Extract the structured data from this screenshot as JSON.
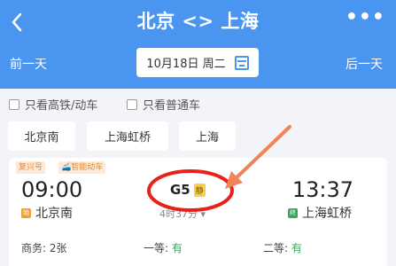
{
  "header": {
    "back_icon": "chevron-left",
    "title": "北京 <> 上海",
    "more_icon": "more-dots",
    "more_label": "•••",
    "prev_day": "前一天",
    "date": "10月18日 周二",
    "next_day": "后一天"
  },
  "filters": [
    {
      "label": "只看高铁/动车"
    },
    {
      "label": "只看普通车"
    }
  ],
  "stations": [
    "北京南",
    "上海虹桥",
    "上海"
  ],
  "train": {
    "tags": [
      "复兴号",
      "智能动车"
    ],
    "departure_time": "09:00",
    "departure_station": "北京南",
    "departure_badge": "始",
    "train_no": "G5",
    "quiet_tag": "静",
    "duration": "4时37分",
    "arrival_time": "13:37",
    "arrival_station": "上海虹桥",
    "arrival_badge": "终",
    "seats": [
      {
        "label": "商务: ",
        "value": "2张"
      },
      {
        "label": "一等: ",
        "value": "有"
      },
      {
        "label": "二等: ",
        "value": "有"
      }
    ]
  },
  "colors": {
    "header_bg": "#4a95f0",
    "annotation_red": "#e8221b",
    "annotation_arrow": "#f0845a",
    "available_green": "#3ba55c"
  }
}
